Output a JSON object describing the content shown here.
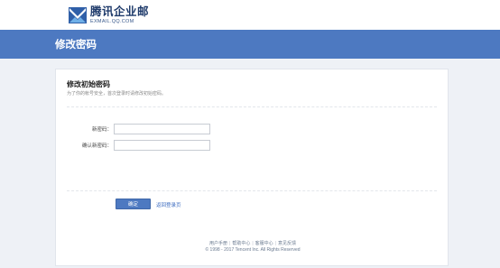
{
  "brand": {
    "name_cn": "腾讯企业邮",
    "name_en": "EXMAIL.QQ.COM"
  },
  "banner": {
    "title": "修改密码"
  },
  "form": {
    "title": "修改初始密码",
    "subtitle": "为了你的帐号安全，首次登录时请修改初始密码。",
    "new_password_label": "新密码：",
    "new_password_value": "",
    "confirm_password_label": "确认新密码：",
    "confirm_password_value": "",
    "submit_label": "确定",
    "back_link": "返回登录页"
  },
  "footer": {
    "links": [
      "用户手册",
      "帮助中心",
      "客服中心",
      "意见反馈"
    ],
    "copyright": "© 1998 - 2017 Tencent Inc. All Rights Reserved"
  },
  "colors": {
    "banner": "#4d79c1",
    "background": "#eef1f6",
    "link": "#3d6cc0"
  }
}
